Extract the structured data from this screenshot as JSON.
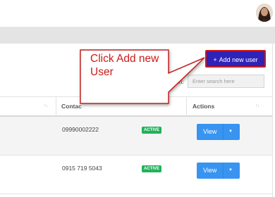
{
  "header": {
    "avatar_icon": "user-avatar"
  },
  "toolbar": {
    "add_button_label": "Add new user",
    "add_button_icon": "+"
  },
  "search": {
    "label": "ch:",
    "placeholder": "Enter search here"
  },
  "table": {
    "columns": [
      {
        "label": "",
        "sort_icon": "↑↓"
      },
      {
        "label": "Contac",
        "sort_icon": ""
      },
      {
        "label": "",
        "sort_icon": ""
      },
      {
        "label": "Actions",
        "sort_icon": "↑↓"
      }
    ],
    "rows": [
      {
        "contact": "09990002222",
        "status": "ACTIVE",
        "action_label": "View",
        "action_caret": "▼"
      },
      {
        "contact": "0915 719 5043",
        "status": "ACTIVE",
        "action_label": "View",
        "action_caret": "▼"
      }
    ]
  },
  "annotation": {
    "text": "Click Add new User",
    "color": "#cc1a1a"
  },
  "colors": {
    "add_button": "#2f22b8",
    "view_button": "#3894f0",
    "status_active": "#21b15b"
  }
}
